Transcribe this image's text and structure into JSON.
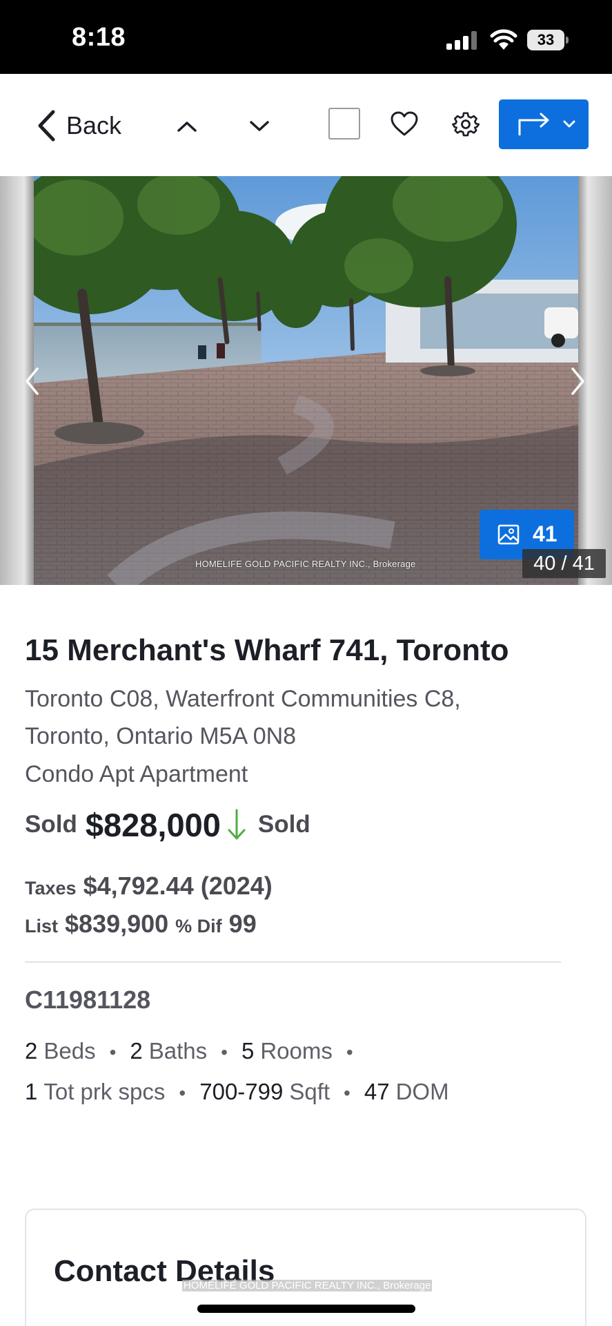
{
  "status_bar": {
    "time": "8:18",
    "battery": "33"
  },
  "toolbar": {
    "back_label": "Back",
    "icons": [
      "chevron-left-icon",
      "chevron-up-icon",
      "chevron-down-icon",
      "checkbox-icon",
      "heart-icon",
      "gear-icon",
      "share-arrow-icon",
      "chevron-down-icon"
    ],
    "accent_color": "#0d6fde"
  },
  "gallery": {
    "photo_credit": "HOMELIFE GOLD PACIFIC REALTY INC., Brokerage",
    "photo_count": "41",
    "photo_index": "40 / 41"
  },
  "listing": {
    "title": "15 Merchant's Wharf 741, Toronto",
    "address_line1": "Toronto C08, Waterfront Communities C8,",
    "address_line2": "Toronto, Ontario M5A 0N8",
    "property_type": "Condo Apt Apartment",
    "sold_label": "Sold",
    "sold_price": "$828,000",
    "status": "Sold",
    "taxes_label": "Taxes",
    "taxes_value": "$4,792.44 (2024)",
    "list_label": "List",
    "list_price": "$839,900",
    "dif_label": "% Dif",
    "dif_value": "99",
    "mls_number": "C11981128",
    "stats": {
      "beds_value": "2",
      "beds_label": "Beds",
      "baths_value": "2",
      "baths_label": "Baths",
      "rooms_value": "5",
      "rooms_label": "Rooms",
      "parking_value": "1",
      "parking_label": "Tot prk spcs",
      "sqft_value": "700-799",
      "sqft_label": "Sqft",
      "dom_value": "47",
      "dom_label": "DOM"
    },
    "price_drop_color": "#4caf3f"
  },
  "contact": {
    "title": "Contact Details",
    "footer_credit": "HOMELIFE GOLD PACIFIC REALTY INC., Brokerage"
  }
}
